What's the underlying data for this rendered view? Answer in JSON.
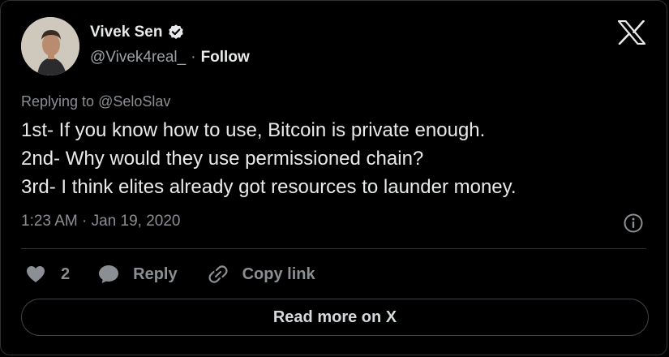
{
  "author": {
    "name": "Vivek Sen",
    "handle": "@Vivek4real_",
    "separator": "·",
    "follow_label": "Follow"
  },
  "reply_context": {
    "prefix": "Replying to ",
    "mention": "@SeloSlav"
  },
  "tweet": {
    "lines": [
      "1st- If you know how to use, Bitcoin is private enough.",
      "2nd- Why would they use permissioned chain?",
      "3rd- I think elites already got resources to launder money."
    ],
    "timestamp": "1:23 AM · Jan 19, 2020"
  },
  "actions": {
    "like_count": "2",
    "reply_label": "Reply",
    "copy_label": "Copy link"
  },
  "footer": {
    "read_more_label": "Read more on X"
  },
  "colors": {
    "background": "#000000",
    "text_primary": "#e7e9ea",
    "text_secondary": "#8b8f94",
    "border": "#2f3336",
    "verified_badge": "#e7e9ea"
  },
  "icons": {
    "verified": "verified-badge-icon",
    "brand": "x-logo-icon",
    "info": "info-icon",
    "like": "heart-icon",
    "reply": "speech-bubble-icon",
    "copy": "link-icon"
  }
}
